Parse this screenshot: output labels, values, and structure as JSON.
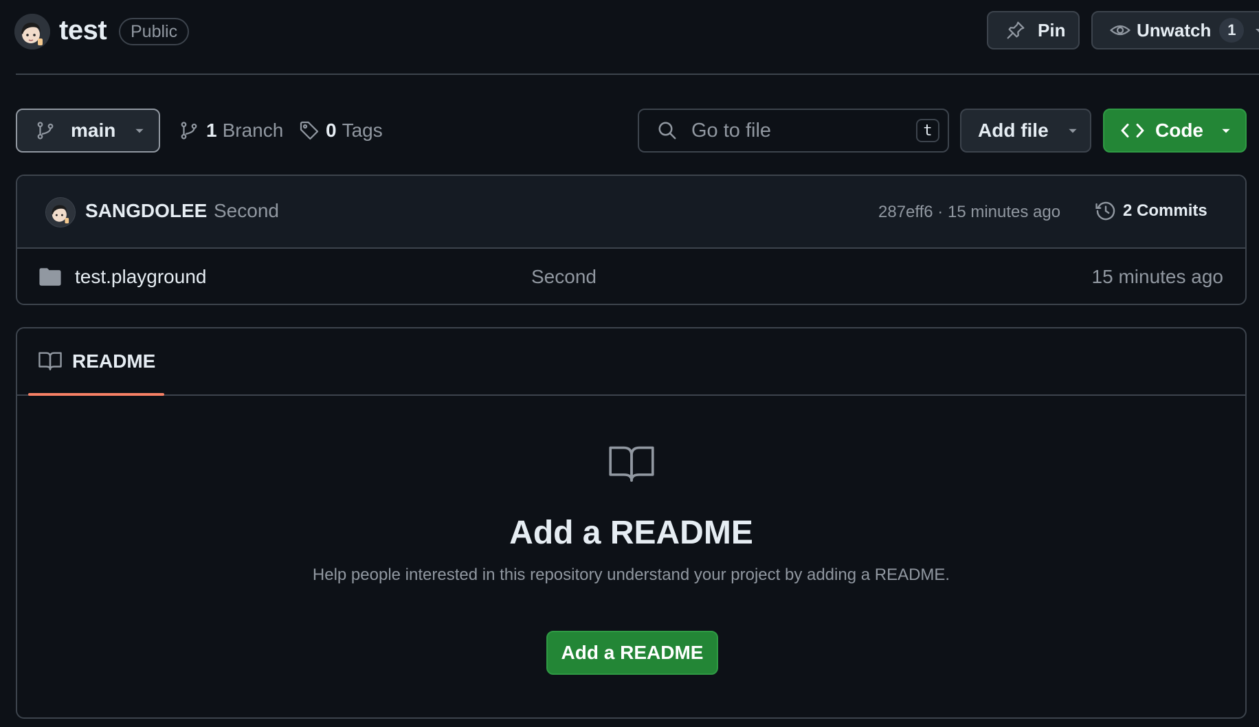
{
  "repo": {
    "name": "test",
    "visibility": "Public"
  },
  "header": {
    "pin_label": "Pin",
    "watch_label": "Unwatch",
    "watch_count": "1"
  },
  "toolbar": {
    "branch": "main",
    "branch_count": "1",
    "branch_label": "Branch",
    "tag_count": "0",
    "tag_label": "Tags",
    "search_placeholder": "Go to file",
    "search_shortcut": "t",
    "add_file_label": "Add file",
    "code_label": "Code"
  },
  "latest_commit": {
    "author": "SANGDOLEE",
    "message": "Second",
    "meta": "287eff6 · 15 minutes ago",
    "commits_label": "2 Commits"
  },
  "files": [
    {
      "icon": "folder-icon",
      "name": "test.playground",
      "message": "Second",
      "time": "15 minutes ago"
    }
  ],
  "readme": {
    "tab_label": "README",
    "empty_title": "Add a README",
    "empty_description": "Help people interested in this repository understand your project by adding a README.",
    "button_label": "Add a README"
  },
  "colors": {
    "background": "#0d1117",
    "border": "#3d444d",
    "primary_green": "#238636",
    "tab_underline": "#f78166",
    "muted_text": "#9198a1"
  }
}
